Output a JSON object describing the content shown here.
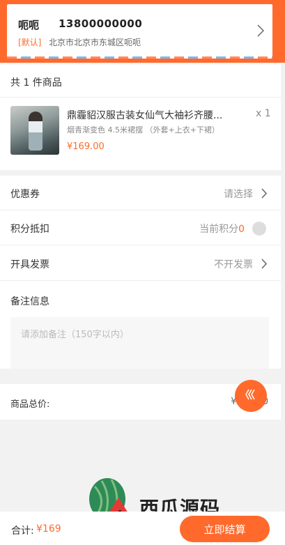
{
  "address": {
    "name": "呃呃",
    "phone": "13800000000",
    "default_tag": "[默认]",
    "full_address": "北京市北京市东城区呃呃",
    "arrow_icon": "chevron-right-icon"
  },
  "goods": {
    "count_text": "共 1 件商品",
    "items": [
      {
        "title": "鼎霾貂汉服古装女仙气大袖衫齐腰...",
        "spec": "烟青渐变色 4.5米裙摆 （外套+上衣+下裙）",
        "price": "¥169.00",
        "quantity": "x 1"
      }
    ]
  },
  "options": {
    "coupon": {
      "label": "优惠券",
      "value": "请选择"
    },
    "points": {
      "label": "积分抵扣",
      "prefix": "当前积分",
      "value": "0"
    },
    "invoice": {
      "label": "开具发票",
      "value": "不开发票"
    },
    "remark": {
      "label": "备注信息",
      "placeholder": "请添加备注（150字以内）"
    }
  },
  "total": {
    "label": "商品总价:",
    "value": "¥169.00"
  },
  "watermark": {
    "text": "西瓜源码"
  },
  "bottom": {
    "sum_label": "合计:",
    "sum_value": "¥169",
    "submit_label": "立即结算"
  },
  "colors": {
    "accent": "#ff6a2c",
    "background": "#f2f2f2",
    "muted_text": "#999999"
  }
}
